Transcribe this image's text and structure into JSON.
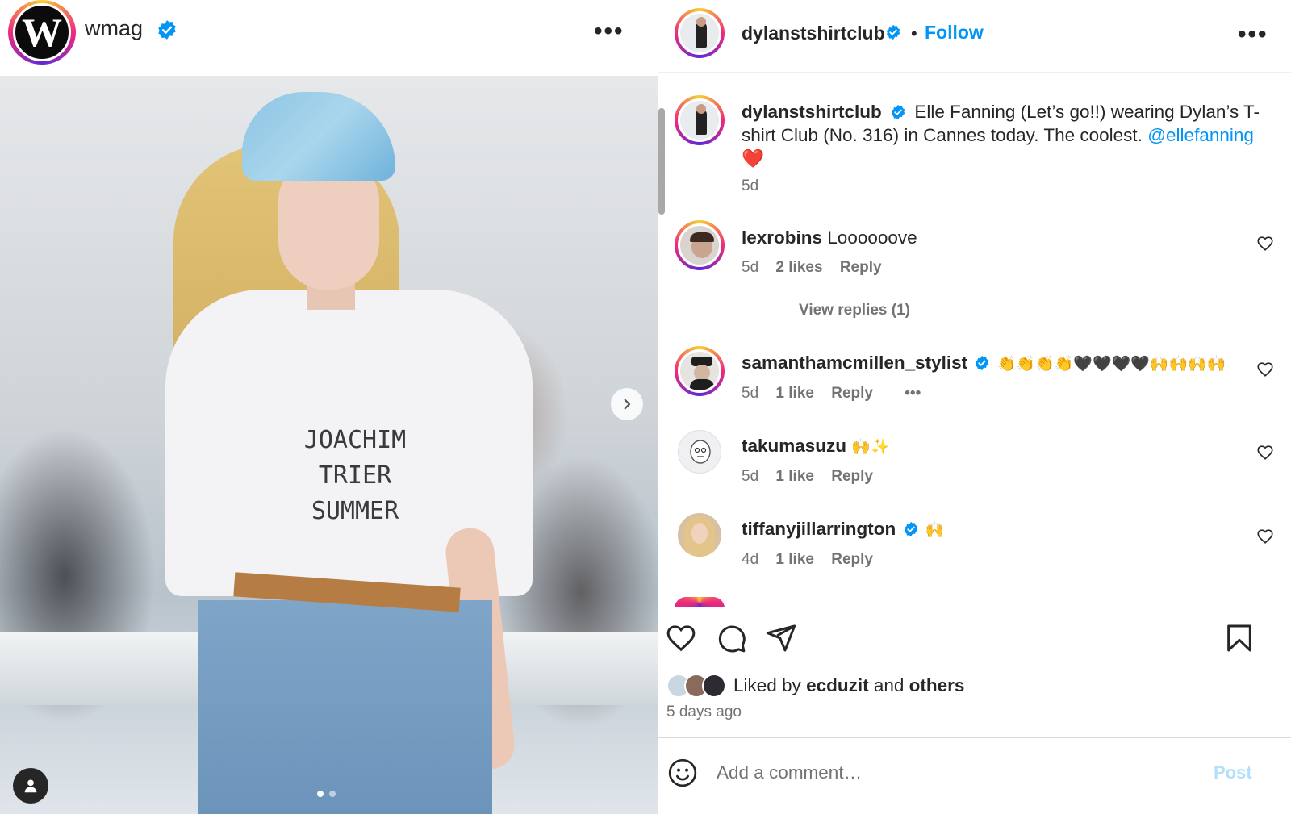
{
  "left_post": {
    "account": {
      "username": "wmag",
      "verified": true,
      "logo_letter": "W"
    },
    "photo": {
      "shirt_text_line1": "JOACHIM TRIER",
      "shirt_text_line2": "SUMMER",
      "slide_count": 2,
      "active_slide": 1
    }
  },
  "right_panel": {
    "header": {
      "username": "dylanstshirtclub",
      "verified": true,
      "separator": "•",
      "follow_label": "Follow"
    },
    "caption": {
      "username": "dylanstshirtclub",
      "text": "Elle Fanning (Let’s go!!) wearing Dylan’s T-shirt Club (No. 316) in Cannes today. The coolest.",
      "mention": "@ellefanning",
      "emoji": "❤️",
      "time": "5d"
    },
    "comments": [
      {
        "username": "lexrobins",
        "verified": false,
        "text": "Loooooove",
        "time": "5d",
        "likes": "2 likes",
        "reply_label": "Reply"
      },
      {
        "username": "samanthamcmillen_stylist",
        "verified": true,
        "text": "👏👏👏👏🖤🖤🖤🖤🙌🙌🙌🙌",
        "time": "5d",
        "likes": "1 like",
        "reply_label": "Reply",
        "more": "•••"
      },
      {
        "username": "takumasuzu",
        "verified": false,
        "text": "🙌✨",
        "time": "5d",
        "likes": "1 like",
        "reply_label": "Reply"
      },
      {
        "username": "tiffanyjillarrington",
        "verified": true,
        "text": "🙌",
        "time": "4d",
        "likes": "1 like",
        "reply_label": "Reply"
      }
    ],
    "view_replies": "View replies (1)",
    "likes": {
      "prefix": "Liked by",
      "user": "ecduzit",
      "conjunction": "and",
      "suffix": "others"
    },
    "time_ago": "5 days ago",
    "comment_box": {
      "placeholder": "Add a comment…",
      "post_label": "Post"
    }
  },
  "icons": {
    "more": "more-horizontal-icon",
    "verified": "verified-badge-icon",
    "like": "heart-icon",
    "comment": "comment-bubble-icon",
    "share": "paper-plane-icon",
    "save": "bookmark-icon",
    "emoji": "smiley-icon",
    "next": "chevron-right-icon",
    "tag": "user-tag-icon"
  },
  "colors": {
    "link_blue": "#0095f6",
    "post_disabled": "#b2dffc",
    "verified_blue": "#0095f6",
    "text": "#262626",
    "muted": "#737373"
  }
}
